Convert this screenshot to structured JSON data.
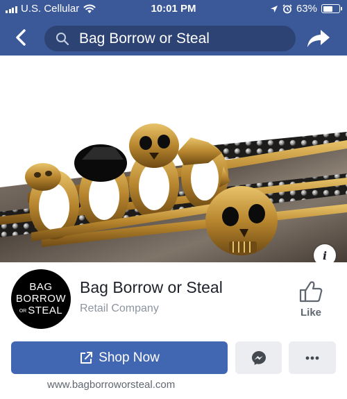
{
  "status_bar": {
    "carrier": "U.S. Cellular",
    "time": "10:01 PM",
    "battery_percent_label": "63%",
    "battery_level": 0.63
  },
  "nav": {
    "search_value": "Bag Borrow or Steal",
    "back_icon": "chevron-left-icon",
    "search_icon": "search-icon",
    "share_icon": "share-arrow-icon"
  },
  "cover": {
    "info_label": "i"
  },
  "page": {
    "logo": {
      "line1": "BAG",
      "line2": "BORROW",
      "line3_prefix": "OR",
      "line3": "STEAL"
    },
    "name": "Bag Borrow or Steal",
    "category": "Retail Company",
    "like_label": "Like"
  },
  "actions": {
    "shop_label": "Shop Now",
    "more_label": "•••"
  },
  "website": "www.bagborroworsteal.com",
  "colors": {
    "facebook_blue": "#3b5998",
    "button_blue": "#4267b2",
    "secondary_button": "#ebedf0"
  }
}
